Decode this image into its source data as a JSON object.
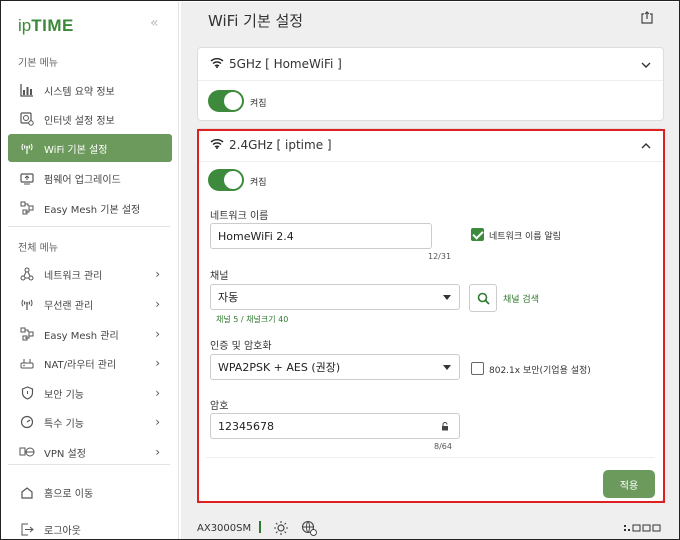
{
  "logo": {
    "prefix": "ip",
    "name": "TIME"
  },
  "sidebar": {
    "basic_title": "기본 메뉴",
    "basic_items": [
      {
        "label": "시스템 요약 정보",
        "icon": "bar-chart-icon"
      },
      {
        "label": "인터넷 설정 정보",
        "icon": "globe-gear-icon"
      },
      {
        "label": "WiFi 기본 설정",
        "icon": "wifi-antenna-icon",
        "active": true
      },
      {
        "label": "펌웨어 업그레이드",
        "icon": "firmware-icon"
      },
      {
        "label": "Easy Mesh 기본 설정",
        "icon": "mesh-icon"
      }
    ],
    "all_title": "전체 메뉴",
    "all_items": [
      {
        "label": "네트워크 관리",
        "icon": "network-icon"
      },
      {
        "label": "무선랜 관리",
        "icon": "wireless-icon"
      },
      {
        "label": "Easy Mesh 관리",
        "icon": "mesh-icon"
      },
      {
        "label": "NAT/라우터 관리",
        "icon": "router-icon"
      },
      {
        "label": "보안 기능",
        "icon": "shield-icon"
      },
      {
        "label": "특수 기능",
        "icon": "gauge-icon"
      },
      {
        "label": "VPN 설정",
        "icon": "vpn-icon"
      }
    ],
    "home": "홈으로 이동",
    "logout": "로그아웃"
  },
  "header": {
    "title": "WiFi 기본 설정"
  },
  "band5": {
    "title": "5GHz [ HomeWiFi ]",
    "switch_label": "켜짐"
  },
  "band24": {
    "title": "2.4GHz [ iptime ]",
    "switch_label": "켜짐",
    "ssid_label": "네트워크 이름",
    "ssid_value": "HomeWiFi 2.4",
    "ssid_counter": "12/31",
    "broadcast_label": "네트워크 이름 알림",
    "channel_label": "채널",
    "channel_value": "자동",
    "channel_hint": "채널 5 / 채널크기 40",
    "channel_search": "채널 검색",
    "auth_label": "인증 및 암호화",
    "auth_value": "WPA2PSK + AES (권장)",
    "enterprise_label": "802.1x 보안(기업용 설정)",
    "password_label": "암호",
    "password_value": "12345678",
    "password_counter": "8/64",
    "apply": "적용"
  },
  "footer": {
    "model": "AX3000SM"
  },
  "colors": {
    "accent": "#3d8a3d",
    "active_bg": "#6c9a5c",
    "highlight": "#e02020"
  }
}
